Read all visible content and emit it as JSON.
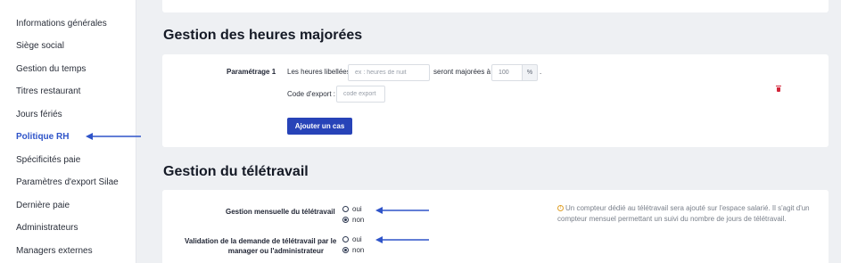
{
  "sidebar": {
    "items": [
      {
        "label": "Informations générales"
      },
      {
        "label": "Siège social"
      },
      {
        "label": "Gestion du temps"
      },
      {
        "label": "Titres restaurant"
      },
      {
        "label": "Jours fériés"
      },
      {
        "label": "Politique RH",
        "active": true
      },
      {
        "label": "Spécificités paie"
      },
      {
        "label": "Paramètres d'export Silae"
      },
      {
        "label": "Dernière paie"
      },
      {
        "label": "Administrateurs"
      },
      {
        "label": "Managers externes"
      }
    ]
  },
  "heures": {
    "title": "Gestion des heures majorées",
    "param_label": "Paramétrage 1",
    "text_before": "Les heures libellées",
    "name_placeholder": "ex : heures de nuit",
    "text_middle": "seront majorées à",
    "percent_value": "100",
    "percent_suffix": "%",
    "period": ".",
    "export_label": "Code d'export :",
    "export_placeholder": "code export",
    "add_button": "Ajouter un cas"
  },
  "teletravail": {
    "title": "Gestion du télétravail",
    "q1": {
      "label": "Gestion mensuelle du télétravail",
      "yes": "oui",
      "no": "non",
      "selected": "non"
    },
    "q2": {
      "label_line1": "Validation de la demande de télétravail par le",
      "label_line2": "manager ou l'administrateur",
      "yes": "oui",
      "no": "non",
      "selected": "non"
    },
    "info_icon": "warning-circle-icon",
    "info_line1": "Un compteur dédié au télétravail sera ajouté sur l'espace salarié. Il s'agit d'un",
    "info_line2": "compteur mensuel permettant un suivi du nombre de jours de télétravail."
  },
  "colors": {
    "accent": "#2f54c9",
    "button": "#2743b8",
    "danger": "#d3263a",
    "warning": "#e0a12a"
  }
}
